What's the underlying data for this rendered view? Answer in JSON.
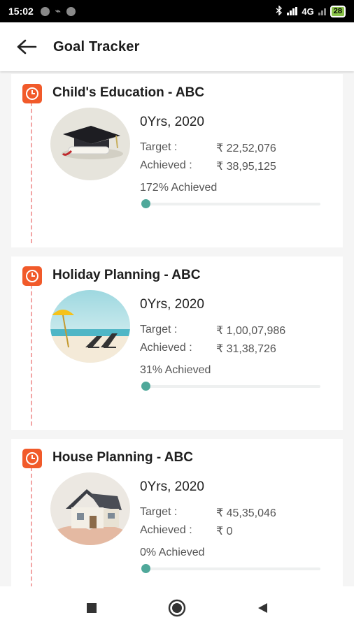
{
  "status_bar": {
    "time": "15:02",
    "network": "4G",
    "battery": "28"
  },
  "header": {
    "title": "Goal Tracker"
  },
  "goals": [
    {
      "title": "Child's Education - ABC",
      "image_icon": "graduation-cap-image",
      "year": "0Yrs, 2020",
      "target_label": "Target :",
      "target_value": "₹ 22,52,076",
      "achieved_label": "Achieved :",
      "achieved_value": "₹ 38,95,125",
      "achieved_text": "172% Achieved",
      "progress_percent": 172
    },
    {
      "title": "Holiday Planning - ABC",
      "image_icon": "beach-chairs-image",
      "year": "0Yrs, 2020",
      "target_label": "Target :",
      "target_value": "₹ 1,00,07,986",
      "achieved_label": "Achieved :",
      "achieved_value": "₹ 31,38,726",
      "achieved_text": "31% Achieved",
      "progress_percent": 31
    },
    {
      "title": "House Planning - ABC",
      "image_icon": "house-image",
      "year": "0Yrs, 2020",
      "target_label": "Target :",
      "target_value": "₹ 45,35,046",
      "achieved_label": "Achieved :",
      "achieved_value": "₹ 0",
      "achieved_text": "0% Achieved",
      "progress_percent": 0
    }
  ],
  "colors": {
    "accent": "#f15a2a",
    "progress": "#4fa89a",
    "timeline": "#f2a4a4"
  },
  "nav": {
    "icons": [
      "recents-square-icon",
      "home-circle-icon",
      "back-triangle-icon"
    ]
  }
}
